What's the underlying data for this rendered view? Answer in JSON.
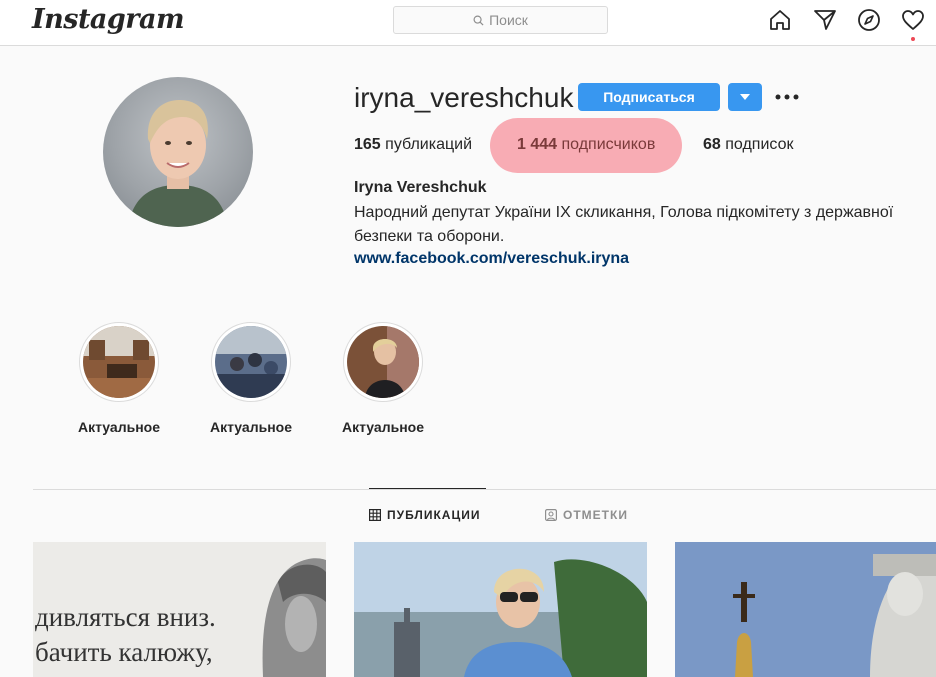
{
  "header": {
    "logo": "Instagram",
    "search_placeholder": "Поиск"
  },
  "nav_icons": [
    "home-icon",
    "direct-icon",
    "explore-icon",
    "activity-heart-icon"
  ],
  "profile": {
    "username": "iryna_vereshchuk",
    "follow_label": "Подписаться",
    "stats": {
      "posts_count": "165",
      "posts_label": "публикаций",
      "followers_count": "1 444",
      "followers_label": "подписчиков",
      "following_count": "68",
      "following_label": "подписок"
    },
    "full_name": "Iryna Vereshchuk",
    "bio": "Народний депутат України IX скликання, Голова підкомітету з державної безпеки та оборони.",
    "link": "www.facebook.com/vereschuk.iryna"
  },
  "highlights": [
    {
      "label": "Актуальное"
    },
    {
      "label": "Актуальное"
    },
    {
      "label": "Актуальное"
    }
  ],
  "tabs": [
    {
      "label": "ПУБЛИКАЦИИ",
      "active": true
    },
    {
      "label": "ОТМЕТКИ",
      "active": false
    }
  ],
  "posts": [
    {
      "text_lines": [
        "дивляться вниз.",
        "бачить калюжу,"
      ]
    },
    {},
    {}
  ],
  "colors": {
    "accent": "#3897f0",
    "link": "#003569",
    "highlight": "#f7a3ac",
    "notification": "#ed4956"
  }
}
